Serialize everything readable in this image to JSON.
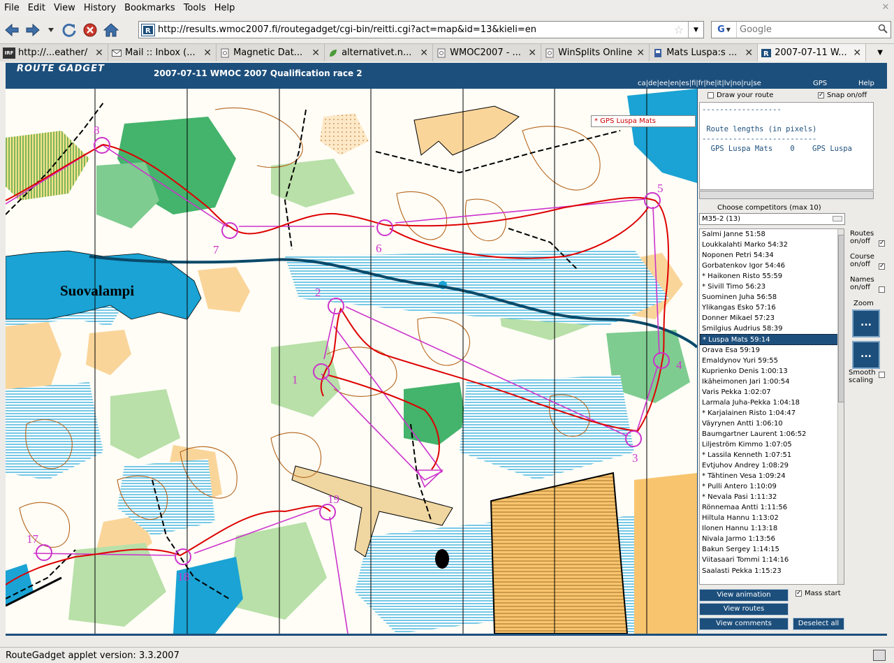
{
  "menubar": {
    "items": [
      "File",
      "Edit",
      "View",
      "History",
      "Bookmarks",
      "Tools",
      "Help"
    ],
    "accel": [
      "F",
      "E",
      "V",
      "s",
      "B",
      "T",
      "H"
    ]
  },
  "navbar": {
    "url": "http://results.wmoc2007.fi/routegadget/cgi-bin/reitti.cgi?act=map&id=13&kieli=en",
    "search_placeholder": "Google",
    "search_engine_icon": "G"
  },
  "tabs": [
    {
      "label": "http://...eather/",
      "icon": "irf-icon"
    },
    {
      "label": "Mail :: Inbox (...",
      "icon": "mail-icon"
    },
    {
      "label": "Magnetic Dat...",
      "icon": "page-icon"
    },
    {
      "label": "alternativet.n...",
      "icon": "leaf-icon"
    },
    {
      "label": "WMOC2007 - ...",
      "icon": "page-icon"
    },
    {
      "label": "WinSplits Online",
      "icon": "page-icon"
    },
    {
      "label": "Mats Luspa:s ...",
      "icon": "flag-icon"
    },
    {
      "label": "2007-07-11 W...",
      "icon": "routegadget-icon",
      "active": true
    }
  ],
  "header": {
    "logo": "ROUTE GADGET",
    "title": "2007-07-11 WMOC 2007 Qualification race 2",
    "languages": "ca|de|ee|en|es|fi|fr|he|it|lv|no|ru|se",
    "gps": "GPS",
    "help": "Help"
  },
  "map": {
    "selected_competitor": "* GPS Luspa Mats",
    "lake_name": "Suovalampi",
    "controls": [
      {
        "label": "1"
      },
      {
        "label": "2"
      },
      {
        "label": "3"
      },
      {
        "label": "4"
      },
      {
        "label": "5"
      },
      {
        "label": "6"
      },
      {
        "label": "7"
      },
      {
        "label": "8"
      },
      {
        "label": "17"
      },
      {
        "label": "18"
      },
      {
        "label": "19"
      }
    ]
  },
  "panel": {
    "draw_route": "Draw your route",
    "snap": "Snap on/off",
    "lengths_box": "------------------\n\n Route lengths (in pixels)\n--------------------------\n  GPS Luspa Mats    0    GPS Luspa",
    "choose_title": "Choose competitors (max 10)",
    "group": "M35-2 (13)",
    "competitors": [
      "Salmi Janne 51:58",
      "Loukkalahti Marko 54:32",
      "Noponen Petri 54:34",
      "Gorbatenkov Igor 54:46",
      "* Haikonen Risto 55:59",
      "* Sivill Timo 56:23",
      "Suominen Juha 56:58",
      "Ylikangas Esko 57:16",
      "Donner Mikael 57:23",
      "Smilgius Audrius 58:39",
      "* Luspa Mats 59:14",
      "Orava Esa 59:19",
      "Emaldynov Yuri 59:55",
      "Kuprienko Denis 1:00:13",
      "Ikäheimonen Jari 1:00:54",
      "Varis Pekka 1:02:07",
      "Larmala Juha-Pekka 1:04:18",
      "* Karjalainen Risto 1:04:47",
      "Väyrynen Antti 1:06:10",
      "Baumgartner Laurent 1:06:52",
      "Liljeström Kimmo 1:07:05",
      "* Lassila Kenneth 1:07:51",
      "Evtjuhov Andrey 1:08:29",
      "* Tähtinen Vesa 1:09:24",
      "* Pulli Antero 1:10:09",
      "* Nevala Pasi 1:11:32",
      "Rönnemaa Antti 1:11:56",
      "Hiltula Hannu 1:13:02",
      "Ilonen Hannu 1:13:18",
      "Nivala Jarmo 1:13:56",
      "Bakun Sergey 1:14:15",
      "Viitasaari Tommi 1:14:16",
      "Saalasti Pekka 1:15:23"
    ],
    "selected_index": 10,
    "routes_label": "Routes on/off",
    "course_label": "Course on/off",
    "names_label": "Names on/off",
    "zoom_label": "Zoom",
    "zoom_btn": "...",
    "smooth_label": "Smooth scaling",
    "view_animation": "View animation",
    "mass_start": "Mass start",
    "view_routes": "View routes",
    "view_comments": "View comments",
    "deselect_all": "Deselect all"
  },
  "status": {
    "text": "RouteGadget applet version: 3.3.2007"
  },
  "colors": {
    "frame": "#1d4f7c",
    "course": "#cc33cc",
    "route": "#dd0000",
    "water": "#1aa3d4",
    "contour": "#b5651d"
  }
}
